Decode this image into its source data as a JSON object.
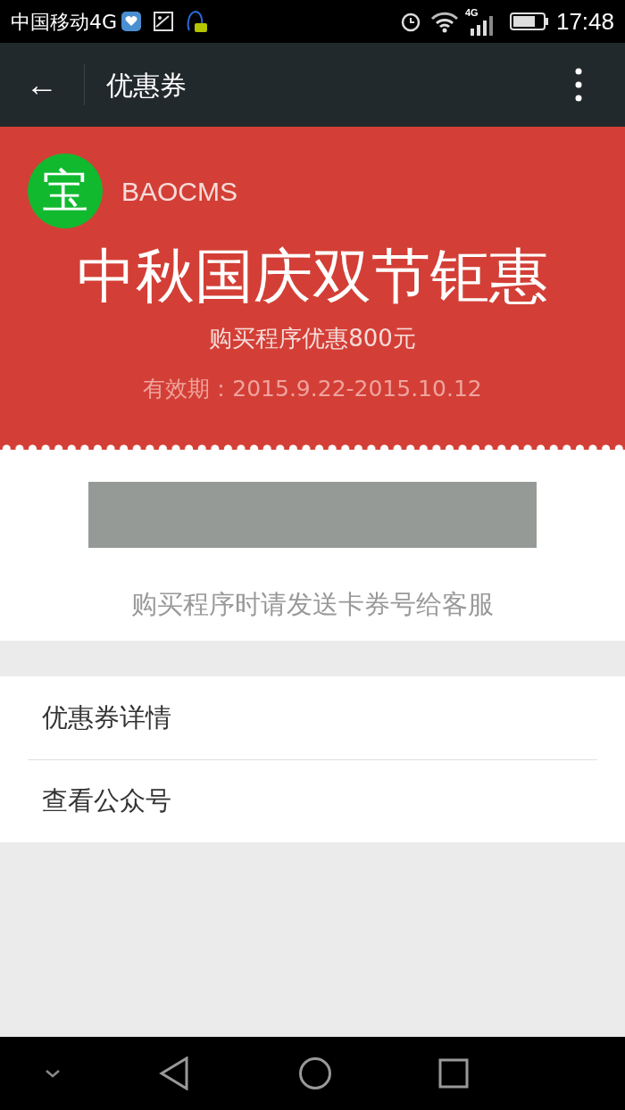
{
  "status_bar": {
    "carrier": "中国移动4G",
    "network_label": "4G",
    "time": "17:48"
  },
  "app_bar": {
    "back_icon": "←",
    "title": "优惠券"
  },
  "coupon": {
    "logo": "宝",
    "brand": "BAOCMS",
    "headline": "中秋国庆双节钜惠",
    "subtitle": "购买程序优惠800元",
    "validity": "有效期：2015.9.22-2015.10.12",
    "note": "购买程序时请发送卡券号给客服"
  },
  "menu": [
    {
      "label": "优惠券详情"
    },
    {
      "label": "查看公众号"
    }
  ]
}
